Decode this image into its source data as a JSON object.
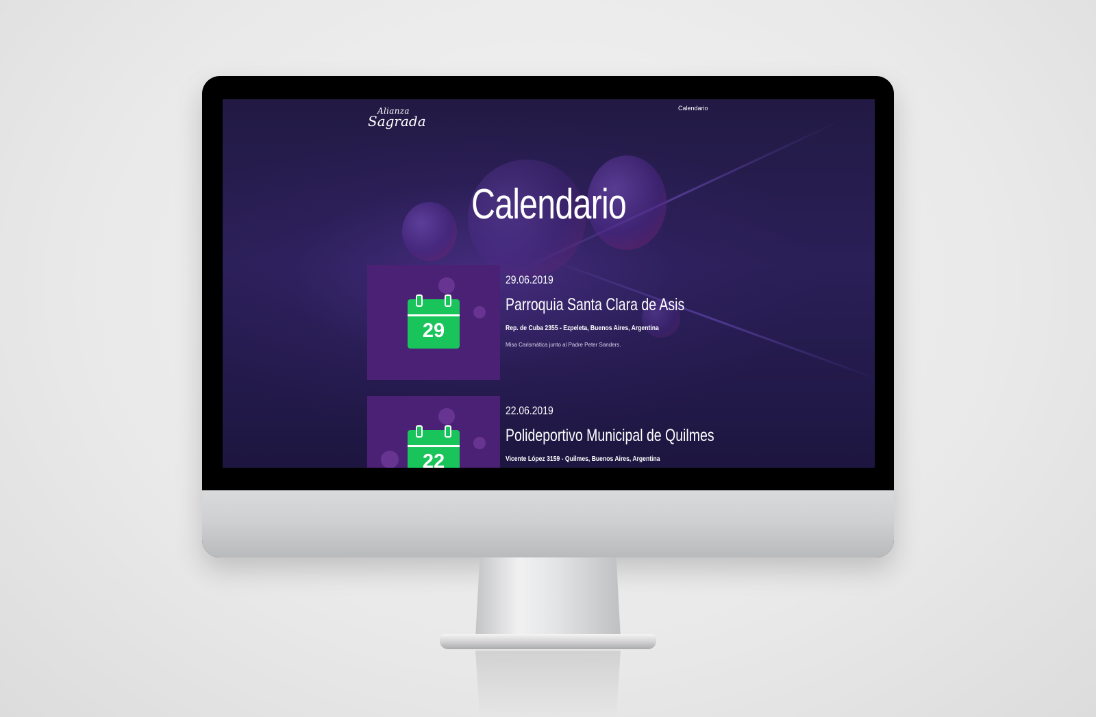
{
  "brand": {
    "logo_top": "Alianza",
    "logo_bottom": "Sagrada"
  },
  "nav": {
    "calendar_link": "Calendario"
  },
  "page": {
    "title": "Calendario"
  },
  "events": [
    {
      "day": "29",
      "date": "29.06.2019",
      "venue": "Parroquia Santa Clara de Asis",
      "address": "Rep. de Cuba 2355 - Ezpeleta, Buenos Aires, Argentina",
      "description": "Misa Carismática junto al Padre Peter Sanders."
    },
    {
      "day": "22",
      "date": "22.06.2019",
      "venue": "Polideportivo Municipal de Quilmes",
      "address": "Vicente López 3159 - Quilmes, Buenos Aires, Argentina",
      "description": ""
    }
  ],
  "colors": {
    "background": "#241b4a",
    "card": "#4a2174",
    "calendar_icon": "#19c45b",
    "text": "#ffffff"
  },
  "icons": {
    "calendar": "calendar-icon"
  }
}
